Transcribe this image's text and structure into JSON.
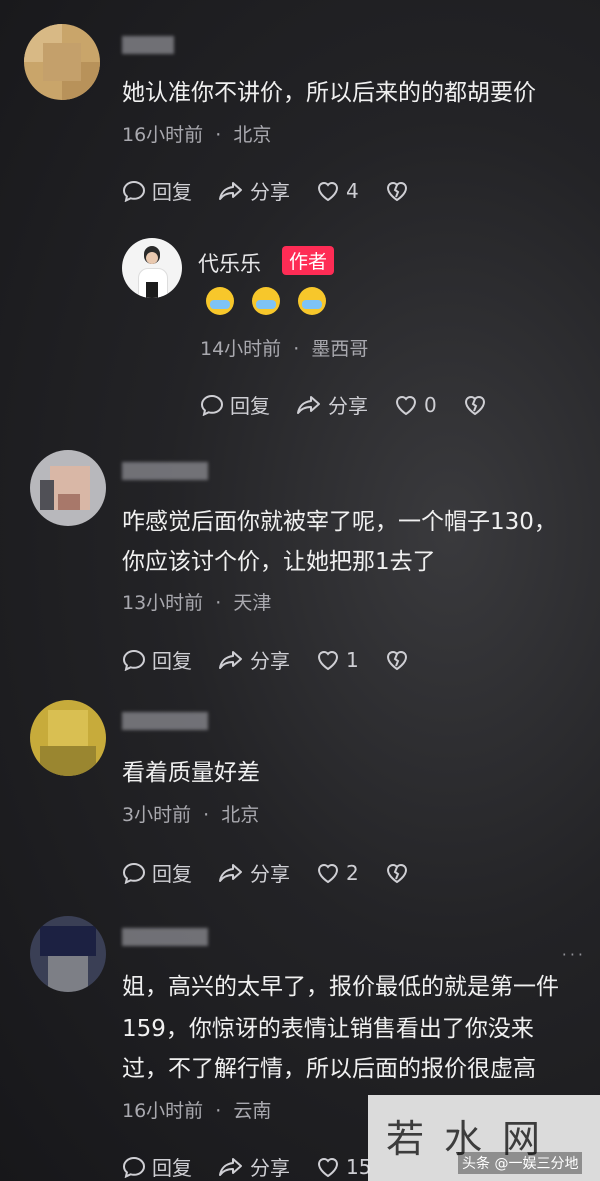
{
  "comments": [
    {
      "text": [
        "她认准你不讲价，所以后来的的都胡要价"
      ],
      "time": "16小时前",
      "location": "北京",
      "reply": "回复",
      "share": "分享",
      "likes": "4"
    },
    {
      "author": "代乐乐",
      "badge": "作者",
      "emojis": [
        "laugh-cry-emoji",
        "laugh-cry-emoji",
        "laugh-cry-emoji"
      ],
      "time": "14小时前",
      "location": "墨西哥",
      "reply": "回复",
      "share": "分享",
      "likes": "0"
    },
    {
      "text": [
        "咋感觉后面你就被宰了呢，一个帽子130，",
        "你应该讨个价，让她把那1去了"
      ],
      "time": "13小时前",
      "location": "天津",
      "reply": "回复",
      "share": "分享",
      "likes": "1"
    },
    {
      "text": [
        "看着质量好差"
      ],
      "time": "3小时前",
      "location": "北京",
      "reply": "回复",
      "share": "分享",
      "likes": "2"
    },
    {
      "text": [
        "姐，高兴的太早了，报价最低的就是第一件",
        "159，你惊讶的表情让销售看出了你没来",
        "过，不了解行情，所以后面的报价很虚高"
      ],
      "time": "16小时前",
      "location": "云南",
      "reply": "回复",
      "share": "分享",
      "likes": "15"
    }
  ],
  "meta_separator": "·",
  "watermark": {
    "big": "若水网",
    "small": "头条 @一娱三分地"
  },
  "more_dots": "···",
  "colors": {
    "badge": "#fe2c55",
    "text": "#f0f0f0",
    "meta": "#a9a9af"
  }
}
